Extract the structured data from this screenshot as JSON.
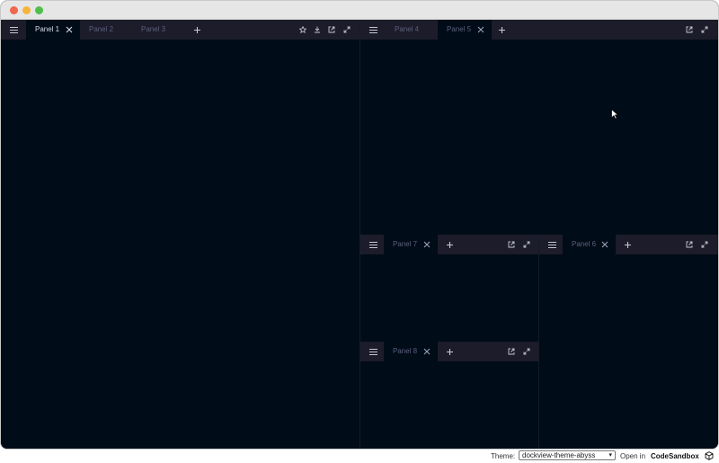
{
  "colors": {
    "background": "#000c18",
    "header": "#1c1c2a",
    "tab_active_text": "#d6d8e6",
    "tab_inactive_text": "#5b5f7d"
  },
  "groups": {
    "left": {
      "tabs": [
        {
          "label": "Panel 1",
          "active": true
        },
        {
          "label": "Panel 2",
          "active": false
        },
        {
          "label": "Panel 3",
          "active": false
        }
      ]
    },
    "top_right": {
      "tabs": [
        {
          "label": "Panel 4",
          "active": false
        },
        {
          "label": "Panel 5",
          "active": true
        }
      ]
    },
    "mid_right_a": {
      "tabs": [
        {
          "label": "Panel 7",
          "active": true
        }
      ]
    },
    "mid_right_b": {
      "tabs": [
        {
          "label": "Panel 6",
          "active": true
        }
      ]
    },
    "bottom_right": {
      "tabs": [
        {
          "label": "Panel 8",
          "active": true
        }
      ]
    }
  },
  "footer": {
    "theme_label": "Theme:",
    "theme_value": "dockview-theme-abyss",
    "open_in": "Open in",
    "codesandbox": "CodeSandbox"
  }
}
